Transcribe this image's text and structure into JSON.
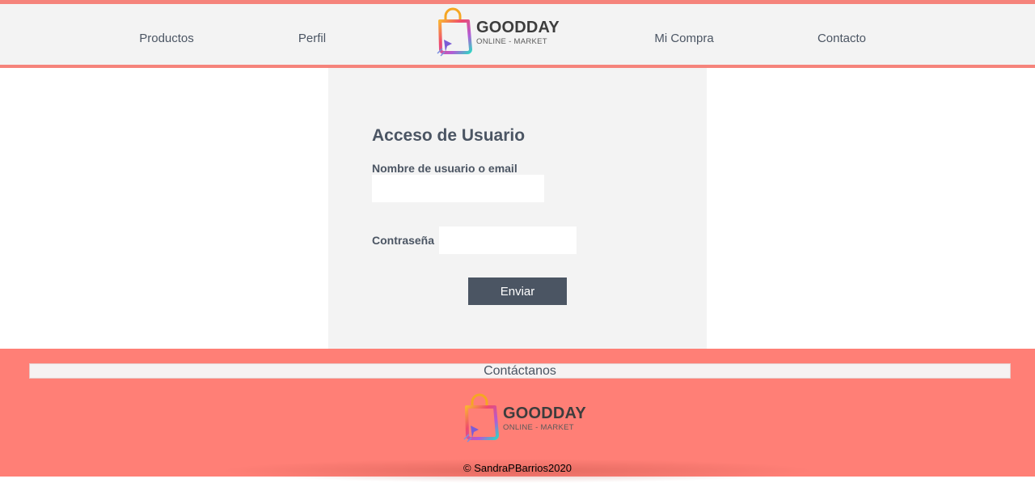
{
  "nav": {
    "items": [
      {
        "label": "Productos"
      },
      {
        "label": "Perfil"
      },
      {
        "label": "Mi Compra"
      },
      {
        "label": "Contacto"
      }
    ],
    "logo": {
      "name": "GOODDAY",
      "sub": "ONLINE - MARKET"
    }
  },
  "login": {
    "title": "Acceso de Usuario",
    "username_label": "Nombre de usuario o email",
    "username_value": "",
    "password_label": "Contraseña",
    "password_value": "",
    "submit_label": "Enviar"
  },
  "footer": {
    "contact_label": "Contáctanos",
    "logo": {
      "name": "GOODDAY",
      "sub": "ONLINE - MARKET"
    },
    "copyright": "© SandraPBarrios2020"
  },
  "colors": {
    "accent": "#f5837b",
    "footer_bg": "#ff7f76",
    "text": "#4b5563",
    "button_bg": "#4b5563",
    "panel_bg": "#f3f3f3"
  },
  "icons": [
    "shopping-bag-logo-icon",
    "cursor-arrow-icon"
  ]
}
